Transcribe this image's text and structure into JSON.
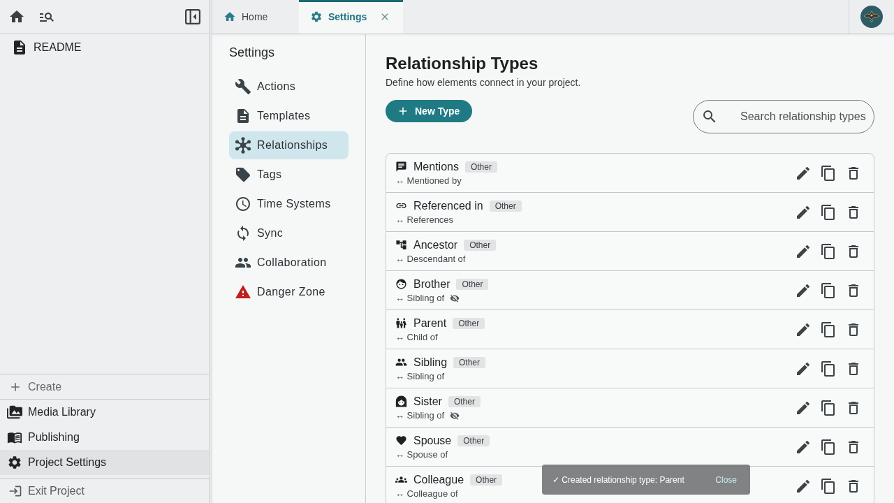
{
  "sidebar": {
    "tree": [
      {
        "label": "README",
        "selected": false
      }
    ],
    "create": "Create",
    "nav": [
      {
        "label": "Media Library",
        "selected": false
      },
      {
        "label": "Publishing",
        "selected": false
      },
      {
        "label": "Project Settings",
        "selected": true
      }
    ],
    "exit": "Exit Project"
  },
  "tabs": [
    {
      "label": "Home",
      "selected": false,
      "closable": false
    },
    {
      "label": "Settings",
      "selected": true,
      "closable": true
    }
  ],
  "settings_nav": {
    "title": "Settings",
    "items": [
      {
        "label": "Actions",
        "selected": false
      },
      {
        "label": "Templates",
        "selected": false
      },
      {
        "label": "Relationships",
        "selected": true
      },
      {
        "label": "Tags",
        "selected": false
      },
      {
        "label": "Time Systems",
        "selected": false
      },
      {
        "label": "Sync",
        "selected": false
      },
      {
        "label": "Collaboration",
        "selected": false
      },
      {
        "label": "Danger Zone",
        "selected": false
      }
    ]
  },
  "page": {
    "title": "Relationship Types",
    "subtitle": "Define how elements connect in your project.",
    "new_button": "New Type",
    "search": {
      "placeholder": "Search relationship types"
    }
  },
  "relationship_types": [
    {
      "name": "Mentions",
      "category": "Other",
      "inverse": "↔ Mentioned by",
      "inverse_hidden": false
    },
    {
      "name": "Referenced in",
      "category": "Other",
      "inverse": "↔ References",
      "inverse_hidden": false
    },
    {
      "name": "Ancestor",
      "category": "Other",
      "inverse": "↔ Descendant of",
      "inverse_hidden": false
    },
    {
      "name": "Brother",
      "category": "Other",
      "inverse": "↔ Sibling of",
      "inverse_hidden": true
    },
    {
      "name": "Parent",
      "category": "Other",
      "inverse": "↔ Child of",
      "inverse_hidden": false
    },
    {
      "name": "Sibling",
      "category": "Other",
      "inverse": "↔ Sibling of",
      "inverse_hidden": false
    },
    {
      "name": "Sister",
      "category": "Other",
      "inverse": "↔ Sibling of",
      "inverse_hidden": true
    },
    {
      "name": "Spouse",
      "category": "Other",
      "inverse": "↔ Spouse of",
      "inverse_hidden": false
    },
    {
      "name": "Colleague",
      "category": "Other",
      "inverse": "↔ Colleague of",
      "inverse_hidden": false
    }
  ],
  "toast": {
    "message": "✓ Created relationship type: Parent",
    "action": "Close"
  }
}
